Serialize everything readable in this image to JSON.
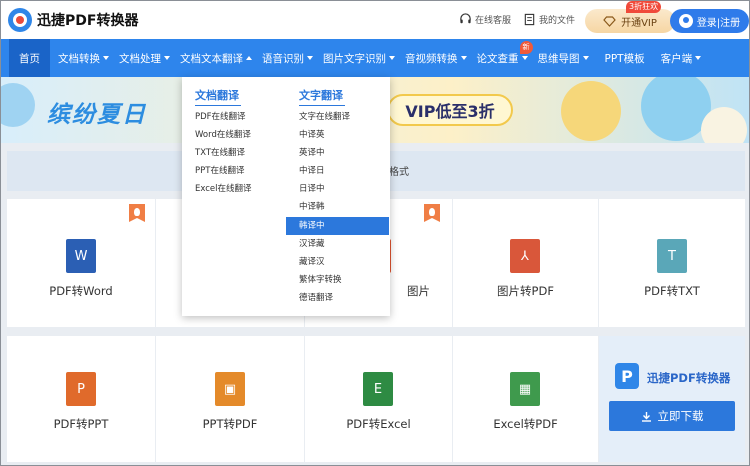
{
  "header": {
    "brand": "迅捷PDF转换器",
    "support": "在线客服",
    "my_files": "我的文件",
    "vip_button": "开通VIP",
    "vip_badge": "3折狂欢",
    "login": "登录|注册"
  },
  "nav": {
    "items": [
      {
        "label": "首页"
      },
      {
        "label": "文档转换"
      },
      {
        "label": "文档处理"
      },
      {
        "label": "文档文本翻译"
      },
      {
        "label": "语音识别"
      },
      {
        "label": "图片文字识别"
      },
      {
        "label": "音视频转换"
      },
      {
        "label": "论文查重"
      },
      {
        "label": "思维导图"
      },
      {
        "label": "PPT模板"
      },
      {
        "label": "客户端"
      }
    ],
    "new_badge": "新"
  },
  "banner": {
    "title": "缤纷夏日",
    "vip_text": "VIP低至3折"
  },
  "subbar": {
    "text": "格式"
  },
  "dropdown": {
    "doc_heading": "文档翻译",
    "doc_items": [
      "PDF在线翻译",
      "Word在线翻译",
      "TXT在线翻译",
      "PPT在线翻译",
      "Excel在线翻译"
    ],
    "text_heading": "文字翻译",
    "text_items": [
      "文字在线翻译",
      "中译英",
      "英译中",
      "中译日",
      "日译中",
      "中译韩",
      "韩译中",
      "汉译藏",
      "藏译汉",
      "繁体字转换",
      "德语翻译"
    ],
    "selected": "韩译中"
  },
  "cards": {
    "row1": [
      {
        "label": "PDF转Word",
        "icon_letter": "W",
        "color": "#2b5fb4"
      },
      {
        "label": "",
        "icon_letter": "",
        "color": ""
      },
      {
        "label": "图片",
        "icon_letter": "",
        "color": "#e0542f"
      },
      {
        "label": "图片转PDF",
        "icon_letter": "⅄",
        "color": "#d9573a"
      },
      {
        "label": "PDF转TXT",
        "icon_letter": "T",
        "color": "#5aa7b8"
      }
    ],
    "row2": [
      {
        "label": "PDF转PPT",
        "icon_letter": "P",
        "color": "#e06a2b"
      },
      {
        "label": "PPT转PDF",
        "icon_letter": "▣",
        "color": "#e48a2a"
      },
      {
        "label": "PDF转Excel",
        "icon_letter": "E",
        "color": "#2e8b43"
      },
      {
        "label": "Excel转PDF",
        "icon_letter": "▦",
        "color": "#3f9a4d"
      }
    ]
  },
  "promo": {
    "name": "迅捷PDF转换器",
    "logo_letter": "P",
    "download": "立即下载"
  }
}
